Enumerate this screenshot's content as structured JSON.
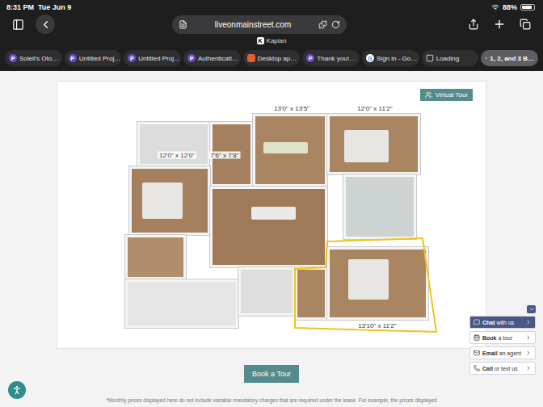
{
  "status_bar": {
    "time": "8:31 PM",
    "date": "Tue Jun 9",
    "battery": "88%",
    "battery_level": 0.88
  },
  "address_bar": {
    "url": "liveonmainstreet.com",
    "subtitle": "Kaplan",
    "subtitle_badge": "K"
  },
  "tabs": [
    {
      "label": "Soleil's Oto…",
      "badge": "P",
      "selected": false
    },
    {
      "label": "Untitled Proj…",
      "badge": "P",
      "selected": false
    },
    {
      "label": "Untitled Proj…",
      "badge": "P",
      "selected": false
    },
    {
      "label": "Authenticati…",
      "badge": "P",
      "selected": false
    },
    {
      "label": "Desktop ap…",
      "badge": "",
      "selected": false
    },
    {
      "label": "Thank you!…",
      "badge": "P",
      "selected": false
    },
    {
      "label": "Sign in - Go…",
      "badge": "G",
      "selected": false
    },
    {
      "label": "Loading",
      "badge": "",
      "selected": false
    },
    {
      "label": "1, 2, and 3 B…",
      "badge": "",
      "selected": true
    }
  ],
  "floor_plan": {
    "virtual_tour": "Virtual Tour",
    "highlighted": true,
    "dimensions": [
      "13'0\" x 13'5\"",
      "12'0\" x 11'2\"",
      "12'0\" x 12'0\"",
      "7'6\" x 7'8\"",
      "13'10\" x 11'2\""
    ]
  },
  "book_button": "Book a Tour",
  "footer_note": "*Monthly prices displayed here do not include variable mandatory charges that are required under the lease. For example, the prices displayed",
  "chat_widget": {
    "items": [
      {
        "strong": "Chat",
        "rest": " with us",
        "selected": true
      },
      {
        "strong": "Book",
        "rest": " a tour",
        "selected": false
      },
      {
        "strong": "Email",
        "rest": " an agent",
        "selected": false
      },
      {
        "strong": "Call",
        "rest": " or text us",
        "selected": false
      }
    ]
  }
}
